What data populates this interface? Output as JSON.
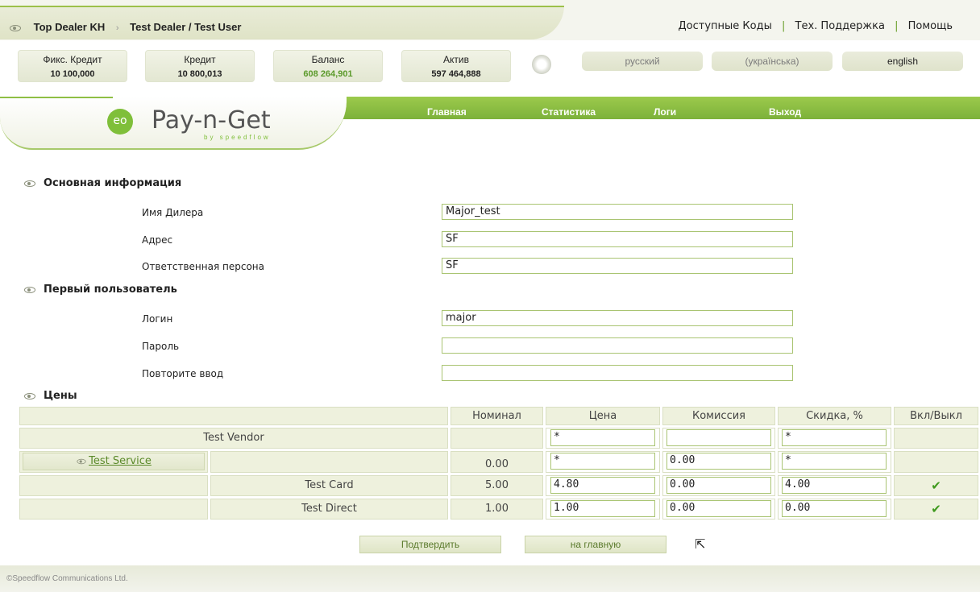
{
  "top": {
    "crumb_dealer": "Top Dealer KH",
    "crumb_user": "Test Dealer / Test User",
    "links": [
      "Доступные Коды",
      "Тех. Поддержка",
      "Помощь"
    ]
  },
  "stats": [
    {
      "label": "Фикс. Кредит",
      "value": "10 100,000"
    },
    {
      "label": "Кредит",
      "value": "10 800,013"
    },
    {
      "label": "Баланс",
      "value": "608 264,901"
    },
    {
      "label": "Актив",
      "value": "597 464,888"
    }
  ],
  "languages": [
    "русский",
    "(українська)",
    "english"
  ],
  "logo": {
    "text": "Pay-n-Get",
    "sub": "by speedflow",
    "badge": "eo"
  },
  "nav": [
    "Главная",
    "Статистика",
    "Логи",
    "Выход"
  ],
  "sections": {
    "basic": "Основная информация",
    "first_user": "Первый пользователь",
    "prices": "Цены"
  },
  "basic_fields": [
    {
      "label": "Имя Дилера",
      "value": "Major_test"
    },
    {
      "label": "Адрес",
      "value": "SF"
    },
    {
      "label": "Ответственная персона",
      "value": "SF"
    }
  ],
  "user_fields": [
    {
      "label": "Логин",
      "value": "major"
    },
    {
      "label": "Пароль",
      "value": ""
    },
    {
      "label": "Повторите ввод",
      "value": ""
    }
  ],
  "price_table": {
    "headers": [
      "Номинал",
      "Цена",
      "Комиссия",
      "Скидка, %",
      "Вкл/Выкл"
    ],
    "vendor": {
      "name": "Test Vendor",
      "price": "*",
      "commission": "",
      "discount": "*"
    },
    "service": {
      "name": "Test Service",
      "nominal": "0.00",
      "price": "*",
      "commission": "0.00",
      "discount": "*"
    },
    "items": [
      {
        "name": "Test Card",
        "nominal": "5.00",
        "price": "4.80",
        "commission": "0.00",
        "discount": "4.00",
        "enabled": "✔"
      },
      {
        "name": "Test Direct",
        "nominal": "1.00",
        "price": "1.00",
        "commission": "0.00",
        "discount": "0.00",
        "enabled": "✔"
      }
    ]
  },
  "buttons": {
    "confirm": "Подтвердить",
    "home": "на главную"
  },
  "footer": "©Speedflow Communications Ltd."
}
